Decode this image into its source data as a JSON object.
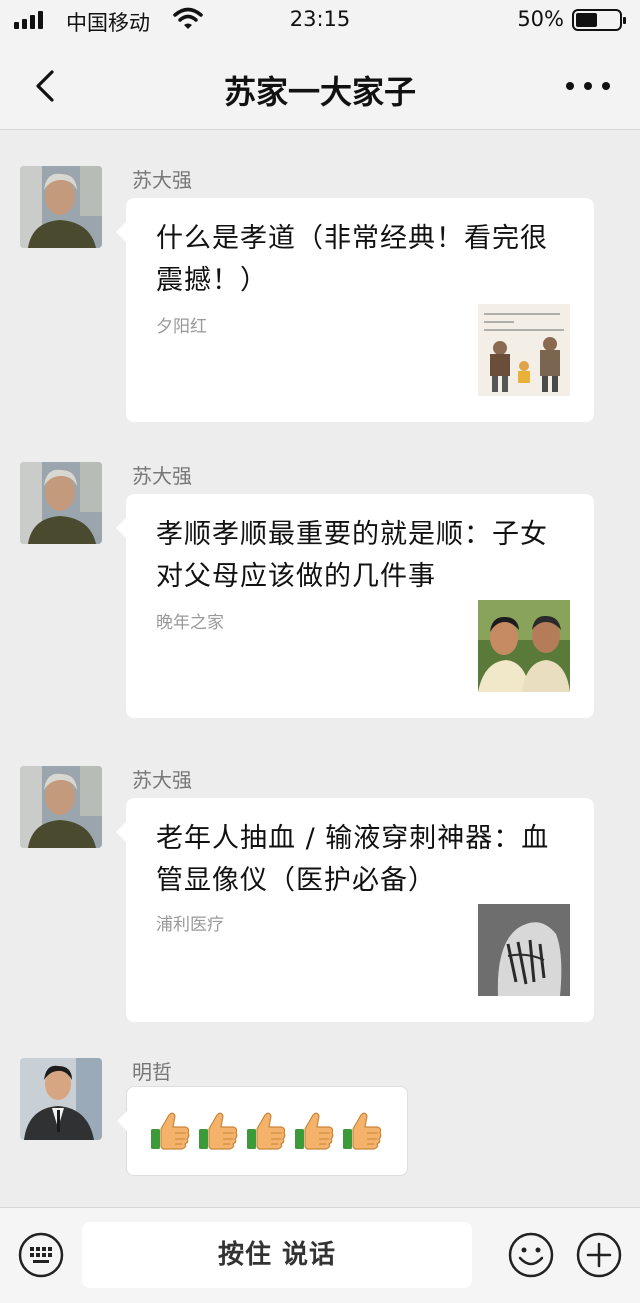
{
  "status_bar": {
    "carrier": "中国移动",
    "time": "23:15",
    "battery": "50%",
    "battery_level": 0.5,
    "icons": [
      "signal-icon",
      "wifi-icon",
      "battery-icon"
    ]
  },
  "nav": {
    "title": "苏家一大家子",
    "icons": [
      "back-icon",
      "more-icon"
    ]
  },
  "messages": [
    {
      "sender": "苏大强",
      "type": "link-card",
      "title": "什么是孝道（非常经典！看完很震撼！）",
      "source": "夕阳红"
    },
    {
      "sender": "苏大强",
      "type": "link-card",
      "title": "孝顺孝顺最重要的就是顺：子女对父母应该做的几件事",
      "source": "晚年之家"
    },
    {
      "sender": "苏大强",
      "type": "link-card",
      "title": "老年人抽血 / 输液穿刺神器：血管显像仪（医护必备）",
      "source": "浦利医疗"
    },
    {
      "sender": "明哲",
      "type": "emoji",
      "emoji": [
        "👍",
        "👍",
        "👍",
        "👍",
        "👍"
      ]
    }
  ],
  "input_bar": {
    "hold_to_talk": "按住 说话",
    "icons": [
      "keyboard-icon",
      "emoji-icon",
      "plus-icon"
    ]
  },
  "colors": {
    "background": "#ededed",
    "bubble": "#ffffff",
    "secondary_text": "#999999",
    "sender_text": "#777777"
  }
}
